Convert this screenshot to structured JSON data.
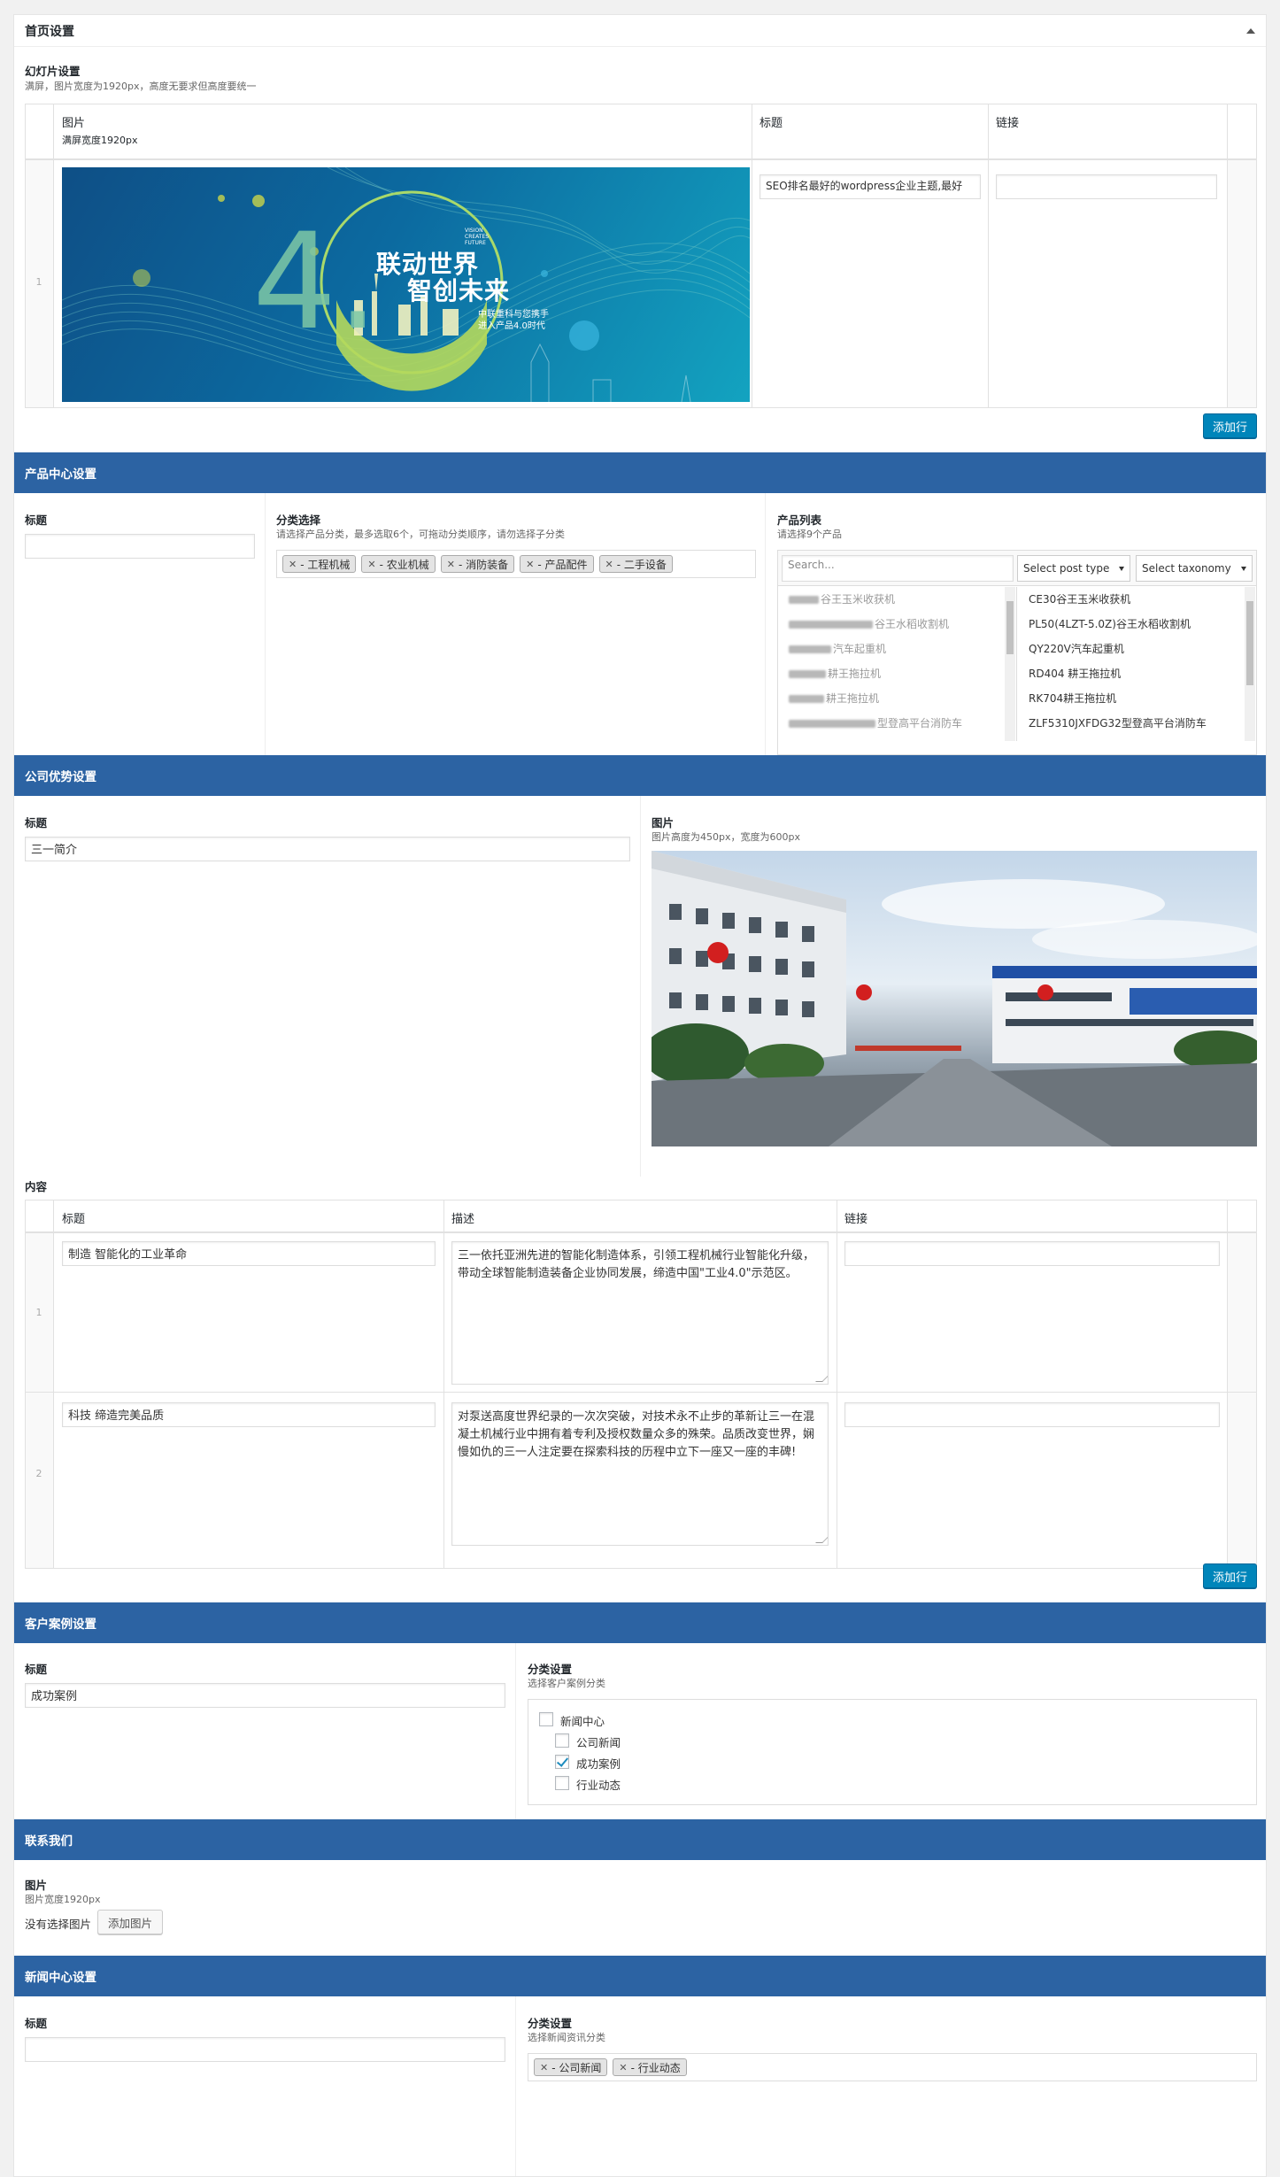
{
  "panel": {
    "title": "首页设置"
  },
  "slides": {
    "label": "幻灯片设置",
    "desc": "满屏，图片宽度为1920px，高度无要求但高度要统一",
    "col_image": "图片",
    "col_image_desc": "满屏宽度1920px",
    "col_title": "标题",
    "col_link": "链接",
    "rows": [
      {
        "num": "1",
        "title_value": "SEO排名最好的wordpress企业主题,最好",
        "link_value": "",
        "banner": {
          "big": "4.",
          "line1": "联动世界",
          "line2": "智创未来",
          "sub1": "中联重科与您携手",
          "sub2": "进入产品4.0时代",
          "small1": "VISION",
          "small2": "CREATES",
          "small3": "FUTURE"
        }
      }
    ],
    "add_row": "添加行"
  },
  "product": {
    "section": "产品中心设置",
    "title_label": "标题",
    "title_value": "",
    "cat_label": "分类选择",
    "cat_desc": "请选择产品分类，最多选取6个，可拖动分类顺序，请勿选择子分类",
    "cats": [
      "- 工程机械",
      "- 农业机械",
      "- 消防装备",
      "- 产品配件",
      "- 二手设备"
    ],
    "list_label": "产品列表",
    "list_desc": "请选择9个产品",
    "search_placeholder": "Search...",
    "post_type": "Select post type",
    "taxonomy": "Select taxonomy",
    "left_items": [
      "谷王玉米收获机",
      "谷王水稻收割机",
      "汽车起重机",
      "耕王拖拉机",
      "耕王拖拉机",
      "型登高平台消防车"
    ],
    "right_items": [
      "CE30谷王玉米收获机",
      "PL50(4LZT-5.0Z)谷王水稻收割机",
      "QY220V汽车起重机",
      "RD404 耕王拖拉机",
      "RK704耕王拖拉机",
      "ZLF5310JXFDG32型登高平台消防车"
    ]
  },
  "advantage": {
    "section": "公司优势设置",
    "title_label": "标题",
    "title_value": "三一简介",
    "image_label": "图片",
    "image_desc": "图片高度为450px，宽度为600px",
    "content_label": "内容",
    "col_title": "标题",
    "col_desc": "描述",
    "col_link": "链接",
    "rows": [
      {
        "num": "1",
        "title": "制造 智能化的工业革命",
        "desc": "三一依托亚洲先进的智能化制造体系，引领工程机械行业智能化升级，带动全球智能制造装备企业协同发展，缔造中国\"工业4.0\"示范区。",
        "link": ""
      },
      {
        "num": "2",
        "title": "科技 缔造完美品质",
        "desc": "对泵送高度世界纪录的一次次突破，对技术永不止步的革新让三一在混凝土机械行业中拥有着专利及授权数量众多的殊荣。品质改变世界，娴慢如仇的三一人注定要在探索科技的历程中立下一座又一座的丰碑!",
        "link": ""
      }
    ],
    "add_row": "添加行"
  },
  "cases": {
    "section": "客户案例设置",
    "title_label": "标题",
    "title_value": "成功案例",
    "cat_label": "分类设置",
    "cat_desc": "选择客户案例分类",
    "tree": [
      {
        "label": "新闻中心",
        "checked": false,
        "level": 0
      },
      {
        "label": "公司新闻",
        "checked": false,
        "level": 1
      },
      {
        "label": "成功案例",
        "checked": true,
        "level": 1
      },
      {
        "label": "行业动态",
        "checked": false,
        "level": 1
      }
    ]
  },
  "contact": {
    "section": "联系我们",
    "image_label": "图片",
    "image_desc": "图片宽度1920px",
    "no_image": "没有选择图片",
    "add_image": "添加图片"
  },
  "news": {
    "section": "新闻中心设置",
    "title_label": "标题",
    "title_value": "",
    "cat_label": "分类设置",
    "cat_desc": "选择新闻资讯分类",
    "cats": [
      "- 公司新闻",
      "- 行业动态"
    ]
  },
  "colors": {
    "section_bar": "#2c63a3",
    "primary_button": "#0085ba",
    "check": "#1e8cbe"
  }
}
